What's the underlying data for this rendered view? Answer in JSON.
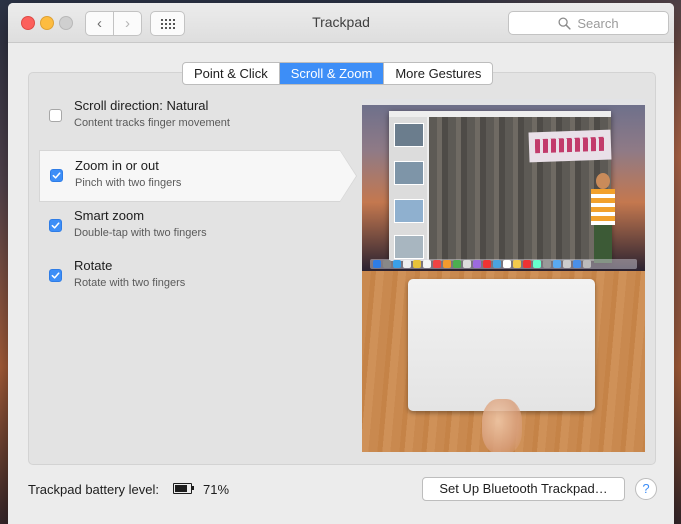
{
  "window": {
    "title": "Trackpad",
    "search_placeholder": "Search"
  },
  "toolbar": {
    "back_icon": "chevron-left-icon",
    "forward_icon": "chevron-right-icon",
    "show_all_icon": "grid-icon"
  },
  "tabs": [
    {
      "label": "Point & Click",
      "active": false
    },
    {
      "label": "Scroll & Zoom",
      "active": true
    },
    {
      "label": "More Gestures",
      "active": false
    }
  ],
  "options": [
    {
      "title": "Scroll direction: Natural",
      "subtitle": "Content tracks finger movement",
      "checked": false,
      "selected": false
    },
    {
      "title": "Zoom in or out",
      "subtitle": "Pinch with two fingers",
      "checked": true,
      "selected": true
    },
    {
      "title": "Smart zoom",
      "subtitle": "Double-tap with two fingers",
      "checked": true,
      "selected": false
    },
    {
      "title": "Rotate",
      "subtitle": "Rotate with two fingers",
      "checked": true,
      "selected": false
    }
  ],
  "footer": {
    "battery_label": "Trackpad battery level:",
    "battery_percent": "71%",
    "battery_level": 0.71,
    "setup_button": "Set Up Bluetooth Trackpad…",
    "help_button": "?"
  },
  "colors": {
    "accent": "#3d8ef7",
    "close": "#fc605c",
    "minimize": "#fdbc40"
  }
}
